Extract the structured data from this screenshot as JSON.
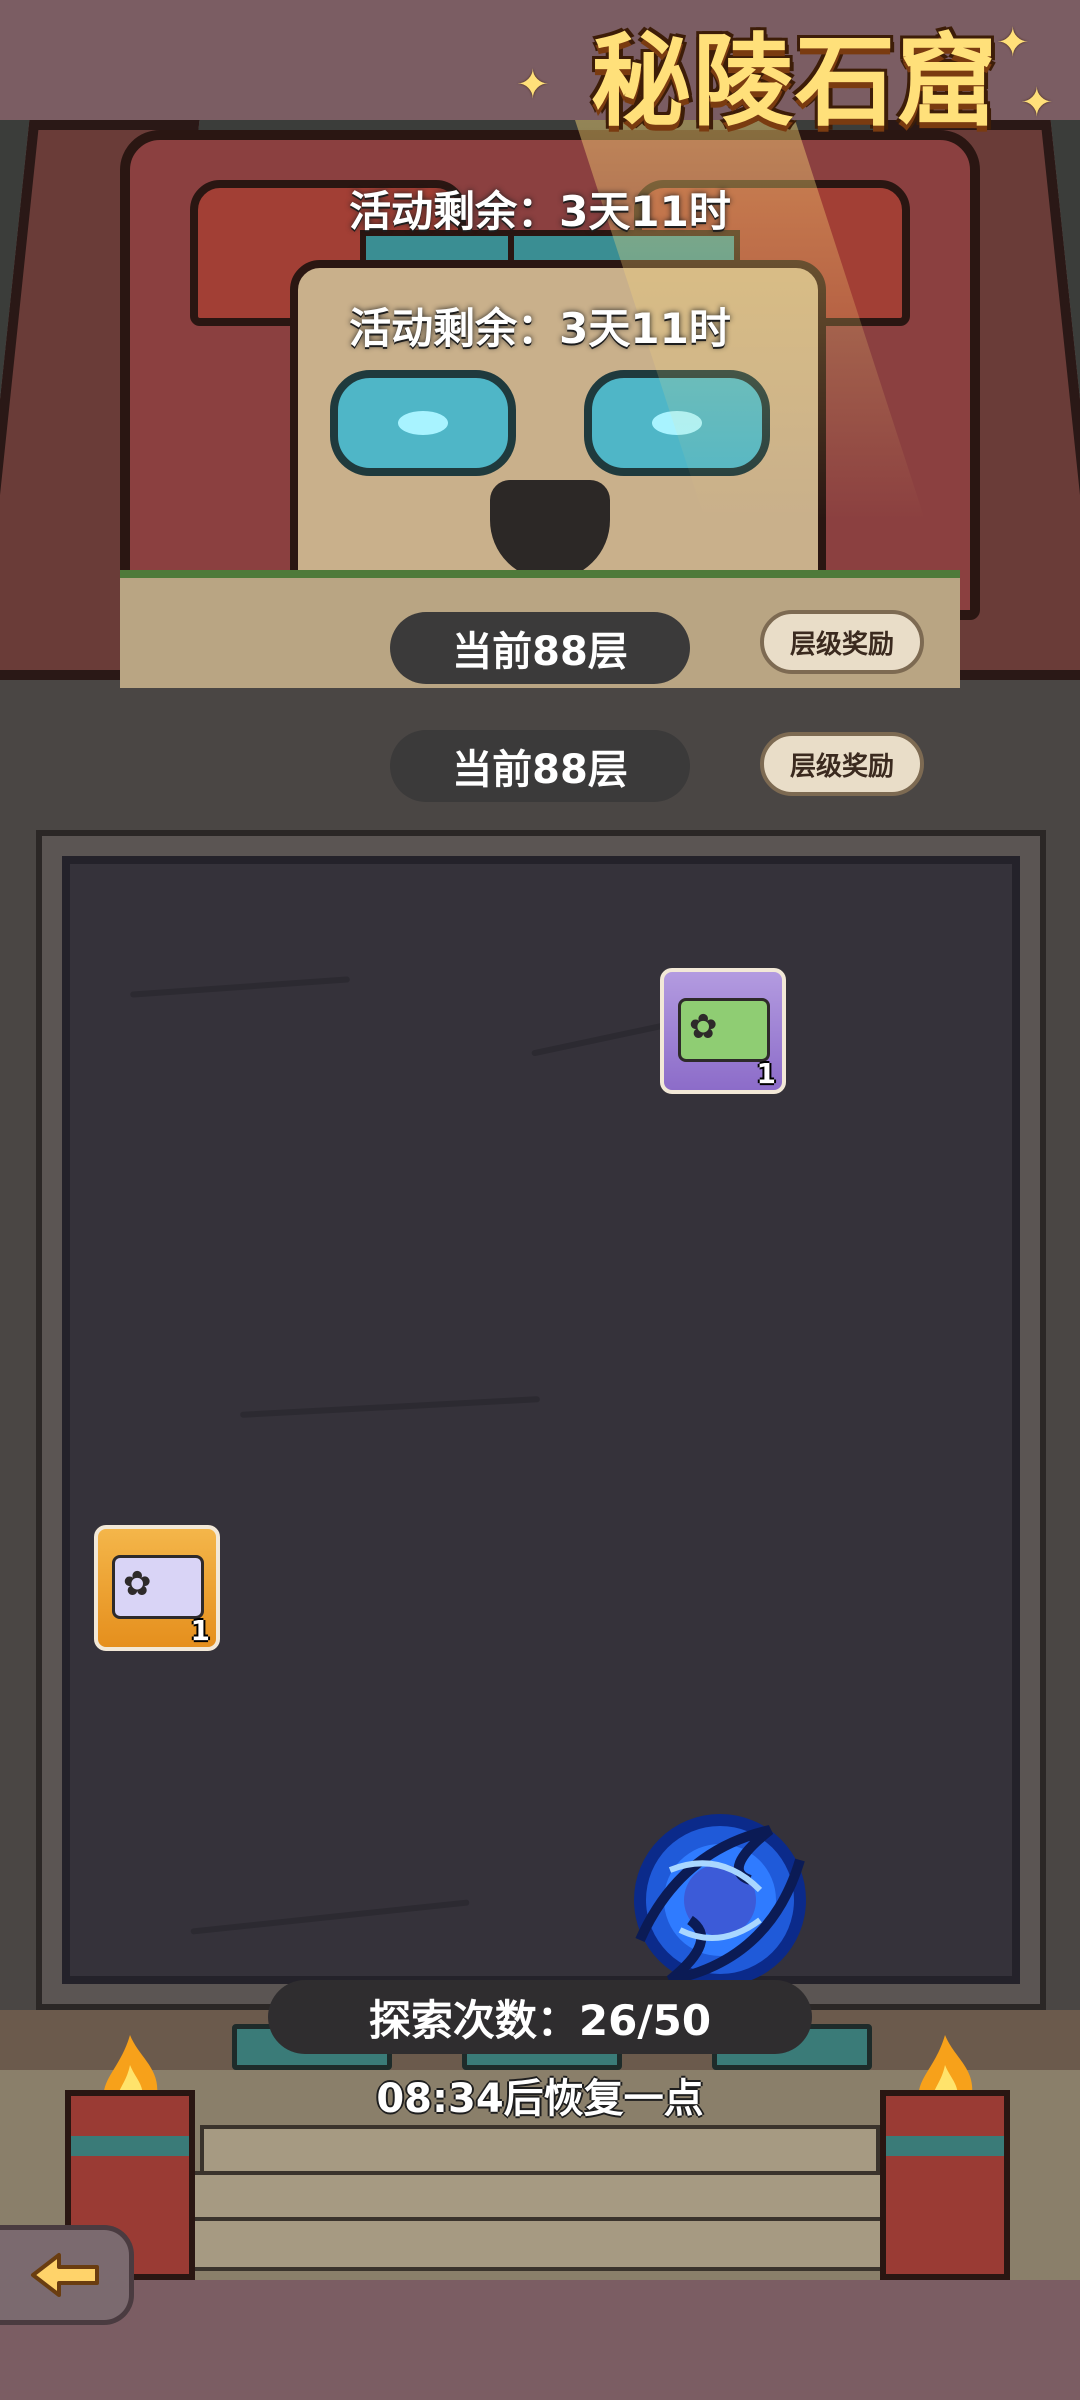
{
  "title": "秘陵石窟",
  "event": {
    "remaining_text": "活动剩余：3天11时"
  },
  "floor": {
    "current_label": "当前88层",
    "reward_button_label": "层级奖励"
  },
  "board": {
    "items": [
      {
        "name": "green-bunny-ticket",
        "count": "1"
      },
      {
        "name": "silver-bunny-ticket",
        "count": "1"
      }
    ]
  },
  "explore": {
    "count_label": "探索次数：26/50",
    "current": 26,
    "max": 50,
    "recover_text": "08:34后恢复一点"
  },
  "colors": {
    "accent_gold": "#ffe07a",
    "portal_blue": "#2f7bff",
    "panel_dark": "#35323a"
  },
  "icons": {
    "back": "arrow-left-icon",
    "portal": "vortex-portal-icon",
    "flame": "flame-icon"
  }
}
